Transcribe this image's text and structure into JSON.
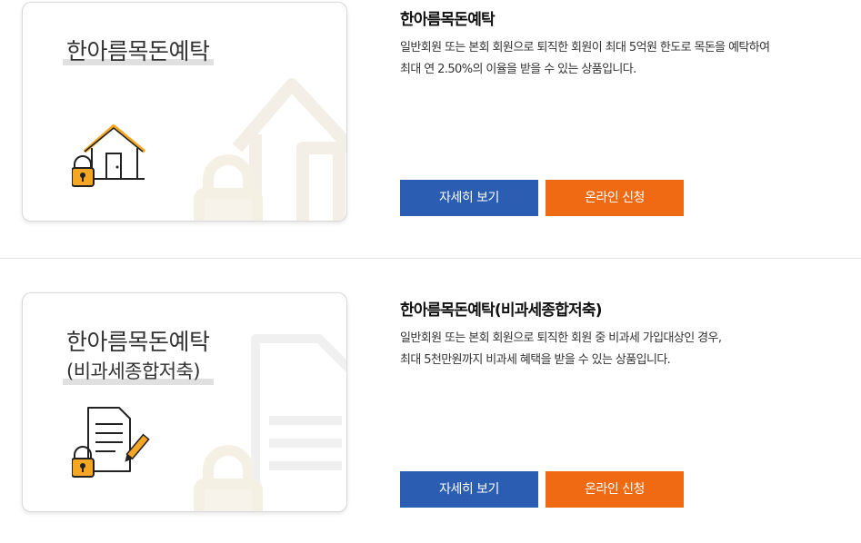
{
  "products": [
    {
      "card_title": "한아름목돈예탁",
      "card_subtitle": "",
      "icon": "house-lock-icon",
      "title": "한아름목돈예탁",
      "desc_line1": "일반회원 또는 본회 회원으로 퇴직한 회원이 최대 5억원 한도로 목돈을 예탁하여",
      "desc_line2": "최대 연 2.50%의 이율을 받을 수 있는 상품입니다.",
      "detail_label": "자세히 보기",
      "apply_label": "온라인 신청"
    },
    {
      "card_title": "한아름목돈예탁",
      "card_subtitle": "(비과세종합저축)",
      "icon": "document-lock-icon",
      "title": "한아름목돈예탁(비과세종합저축)",
      "desc_line1": "일반회원 또는 본회 회원으로 퇴직한 회원 중 비과세 가입대상인 경우,",
      "desc_line2": "최대 5천만원까지 비과세 혜택을 받을 수 있는 상품입니다.",
      "detail_label": "자세히 보기",
      "apply_label": "온라인 신청"
    }
  ],
  "colors": {
    "detail_button": "#2b5db3",
    "apply_button": "#f06a13",
    "icon_accent": "#f5a623"
  }
}
